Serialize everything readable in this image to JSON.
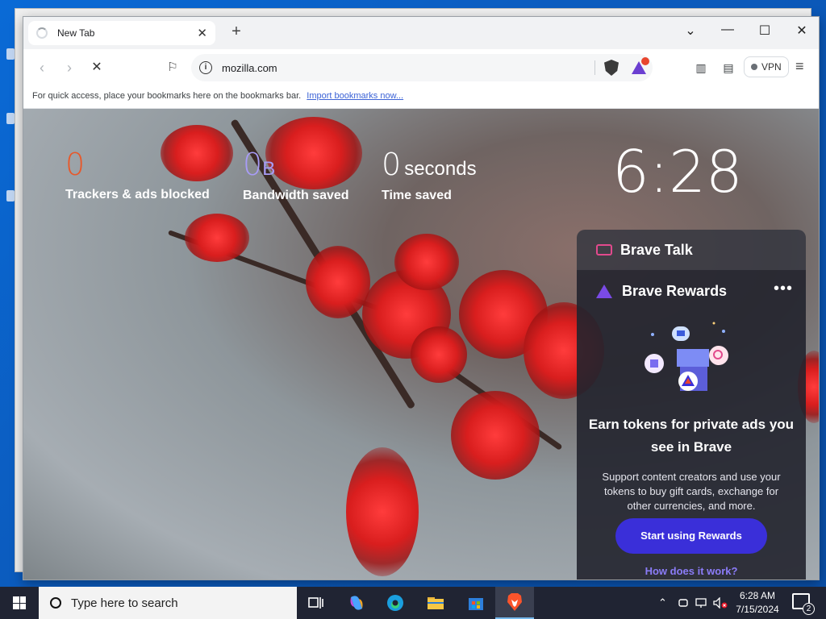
{
  "browser": {
    "tab": {
      "title": "New Tab"
    },
    "address": {
      "value": "mozilla.com"
    },
    "vpn_label": "VPN",
    "bookmarks_bar": {
      "message": "For quick access, place your bookmarks here on the bookmarks bar.",
      "link": "Import bookmarks now..."
    }
  },
  "newtab": {
    "stats": [
      {
        "value": "0",
        "unit": "",
        "label": "Trackers & ads blocked",
        "color": "#e8582a"
      },
      {
        "value": "0",
        "unit": "B",
        "label": "Bandwidth saved",
        "color": "#a89cf7"
      },
      {
        "value": "0",
        "unit": "seconds",
        "label": "Time saved",
        "color": "#ffffff"
      }
    ],
    "clock": "6:28",
    "talk": {
      "title": "Brave Talk"
    },
    "rewards": {
      "title": "Brave Rewards",
      "more": "•••",
      "heading": "Earn tokens for private ads you see in Brave",
      "description": "Support content creators and use your tokens to buy gift cards, exchange for other currencies, and more.",
      "cta": "Start using Rewards",
      "link": "How does it work?"
    }
  },
  "taskbar": {
    "search_placeholder": "Type here to search",
    "time": "6:28 AM",
    "date": "7/15/2024",
    "notifications": "2"
  },
  "colors": {
    "accent": "#3a2fd9",
    "link": "#8b7cf8",
    "taskbar": "#202433"
  }
}
